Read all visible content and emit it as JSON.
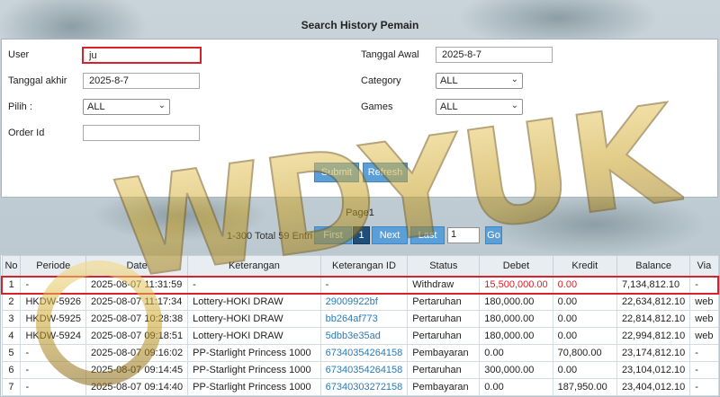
{
  "page_title": "Search History Pemain",
  "form": {
    "user_label": "User",
    "user_value": "ju",
    "tanggal_awal_label": "Tanggal Awal",
    "tanggal_awal_value": "2025-8-7",
    "tanggal_akhir_label": "Tanggal akhir",
    "tanggal_akhir_value": "2025-8-7",
    "category_label": "Category",
    "category_value": "ALL",
    "pilih_label": "Pilih  :",
    "pilih_value": "ALL",
    "games_label": "Games",
    "games_value": "ALL",
    "order_id_label": "Order Id",
    "order_id_value": "",
    "submit_label": "Submit",
    "refresh_label": "Refresh"
  },
  "pager": {
    "page_label": "Page1",
    "info": "1-300 Total 59 Entri",
    "first_label": "First",
    "current_page": "1",
    "next_label": "Next",
    "last_label": "Last",
    "goto_value": "1",
    "go_label": "Go"
  },
  "table": {
    "headers": [
      "No",
      "Periode",
      "Date",
      "Keterangan",
      "Keterangan ID",
      "Status",
      "Debet",
      "Kredit",
      "Balance",
      "Via"
    ],
    "rows": [
      [
        "1",
        "-",
        "2025-08-07 11:31:59",
        "-",
        "-",
        "Withdraw",
        "15,500,000.00",
        "0.00",
        "7,134,812.10",
        "-"
      ],
      [
        "2",
        "HKDW-5926",
        "2025-08-07 11:17:34",
        "Lottery-HOKI DRAW",
        "29009922bf",
        "Pertaruhan",
        "180,000.00",
        "0.00",
        "22,634,812.10",
        "web"
      ],
      [
        "3",
        "HKDW-5925",
        "2025-08-07 10:28:38",
        "Lottery-HOKI DRAW",
        "bb264af773",
        "Pertaruhan",
        "180,000.00",
        "0.00",
        "22,814,812.10",
        "web"
      ],
      [
        "4",
        "HKDW-5924",
        "2025-08-07 09:18:51",
        "Lottery-HOKI DRAW",
        "5dbb3e35ad",
        "Pertaruhan",
        "180,000.00",
        "0.00",
        "22,994,812.10",
        "web"
      ],
      [
        "5",
        "-",
        "2025-08-07 09:16:02",
        "PP-Starlight Princess 1000",
        "67340354264158",
        "Pembayaran",
        "0.00",
        "70,800.00",
        "23,174,812.10",
        "-"
      ],
      [
        "6",
        "-",
        "2025-08-07 09:14:45",
        "PP-Starlight Princess 1000",
        "67340354264158",
        "Pertaruhan",
        "300,000.00",
        "0.00",
        "23,104,012.10",
        "-"
      ],
      [
        "7",
        "-",
        "2025-08-07 09:14:40",
        "PP-Starlight Princess 1000",
        "67340303272158",
        "Pembayaran",
        "0.00",
        "187,950.00",
        "23,404,012.10",
        "-"
      ]
    ]
  },
  "watermark_text": "WDYUK",
  "colors": {
    "accent": "#5a9fd8",
    "active_page": "#1f4e79",
    "highlight": "#d9212c",
    "link": "#2a7ab8",
    "watermark": "#c9a227"
  }
}
